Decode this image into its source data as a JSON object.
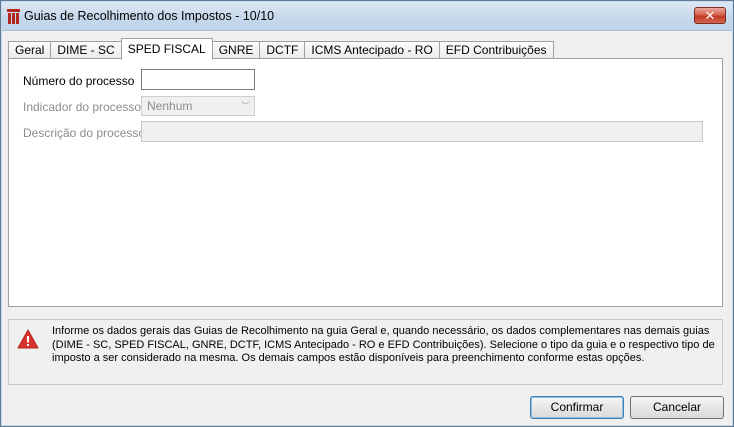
{
  "window": {
    "title": "Guias de Recolhimento dos Impostos - 10/10",
    "close_glyph": "✕"
  },
  "tabs": [
    {
      "label": "Geral",
      "active": false
    },
    {
      "label": "DIME - SC",
      "active": false
    },
    {
      "label": "SPED FISCAL",
      "active": true
    },
    {
      "label": "GNRE",
      "active": false
    },
    {
      "label": "DCTF",
      "active": false
    },
    {
      "label": "ICMS Antecipado - RO",
      "active": false
    },
    {
      "label": "EFD Contribuições",
      "active": false
    }
  ],
  "form": {
    "numero_processo": {
      "label": "Número do processo",
      "value": ""
    },
    "indicador_processo": {
      "label": "Indicador do processo",
      "selected": "Nenhum",
      "disabled": true
    },
    "descricao_processo": {
      "label": "Descrição do processo",
      "value": "",
      "disabled": true
    }
  },
  "info": {
    "icon": "warning-icon",
    "line1": "Informe os dados gerais das Guias de Recolhimento na guia Geral e, quando necessário, os dados complementares nas demais guias",
    "line2": "(DIME - SC, SPED FISCAL, GNRE, DCTF, ICMS Antecipado - RO e EFD Contribuições). Selecione o tipo da guia e o respectivo tipo de",
    "line3": "imposto a ser considerado na mesma. Os demais campos estão disponíveis para preenchimento conforme estas opções."
  },
  "buttons": {
    "confirmar": "Confirmar",
    "cancelar": "Cancelar"
  },
  "colors": {
    "warning": "#d9342b",
    "close_button": "#c13a25",
    "titlebar": "#c5d7eb"
  }
}
